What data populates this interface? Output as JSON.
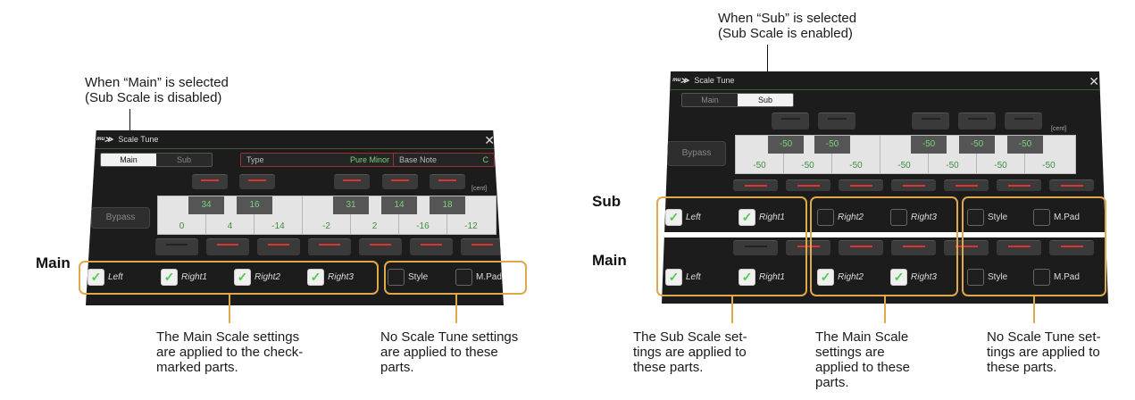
{
  "captions": {
    "left_top": "When “Main” is selected\n(Sub Scale is disabled)",
    "right_top": "When “Sub” is selected\n(Sub Scale is enabled)",
    "left_bottom_1": "The Main Scale settings\nare applied to the check-\nmarked parts.",
    "left_bottom_2": "No Scale Tune settings\nare applied to these\nparts.",
    "right_bottom_1": "The Sub Scale set-\ntings are applied to\nthese parts.",
    "right_bottom_2": "The Main Scale\nsettings are\napplied to these\nparts.",
    "right_bottom_3": "No Scale Tune set-\ntings are applied to\nthese parts."
  },
  "side_labels": {
    "main_left": "Main",
    "sub_right": "Sub",
    "main_right": "Main"
  },
  "window": {
    "title": "Scale Tune",
    "close_glyph": "✕",
    "logo": "ᵐᵘ≫"
  },
  "tabs": {
    "main": "Main",
    "sub": "Sub"
  },
  "fields": {
    "type_label": "Type",
    "type_value": "Pure Minor",
    "base_label": "Base Note",
    "base_value": "C"
  },
  "bypass_label": "Bypass",
  "cent_label": "[cent]",
  "left_panel": {
    "black_values": [
      "34",
      "16",
      "31",
      "14",
      "18"
    ],
    "white_values": [
      "0",
      "4",
      "-14",
      "-2",
      "2",
      "-16",
      "-12"
    ]
  },
  "right_panel": {
    "black_values": [
      "-50",
      "-50",
      "-50",
      "-50",
      "-50"
    ],
    "white_values": [
      "-50",
      "-50",
      "-50",
      "-50",
      "-50",
      "-50",
      "-50"
    ]
  },
  "parts": {
    "left": "Left",
    "right1": "Right1",
    "right2": "Right2",
    "right3": "Right3",
    "style": "Style",
    "mpad": "M.Pad"
  },
  "left_part_states": {
    "left": true,
    "right1": true,
    "right2": true,
    "right3": true,
    "style": false,
    "mpad": false
  },
  "right_sub_states": {
    "left": true,
    "right1": true,
    "right2": false,
    "right3": false,
    "style": false,
    "mpad": false
  },
  "right_main_states": {
    "left": true,
    "right1": true,
    "right2": true,
    "right3": true,
    "style": false,
    "mpad": false
  },
  "colors": {
    "accent_orange": "#e0a848",
    "value_green": "#7bd17b",
    "led_red": "#d33333"
  }
}
